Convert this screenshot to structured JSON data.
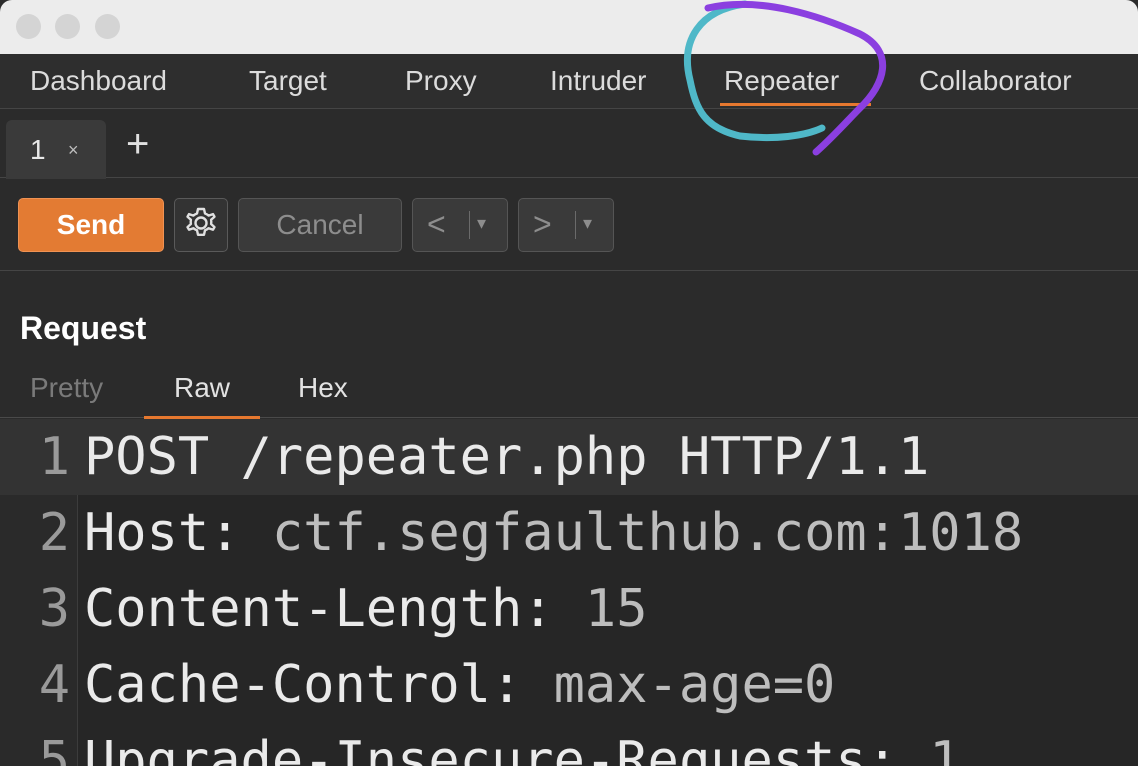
{
  "main_tabs": [
    {
      "label": "Dashboard"
    },
    {
      "label": "Target"
    },
    {
      "label": "Proxy"
    },
    {
      "label": "Intruder"
    },
    {
      "label": "Repeater"
    },
    {
      "label": "Collaborator"
    }
  ],
  "active_tab": "Repeater",
  "repeater_tabs": [
    {
      "label": "1",
      "close": "×"
    }
  ],
  "add_tab_label": "+",
  "toolbar": {
    "send_label": "Send",
    "cancel_label": "Cancel",
    "back_label": "<",
    "forward_label": ">",
    "dropdown_glyph": "▾",
    "settings_icon": "gear-icon"
  },
  "request": {
    "title": "Request",
    "view_tabs": [
      {
        "label": "Pretty"
      },
      {
        "label": "Raw"
      },
      {
        "label": "Hex"
      }
    ],
    "active_view": "Raw",
    "lines": [
      {
        "n": "1",
        "key": "POST /repeater.php HTTP/1.1",
        "value": ""
      },
      {
        "n": "2",
        "key": "Host:",
        "value": " ctf.segfaulthub.com:1018"
      },
      {
        "n": "3",
        "key": "Content-Length:",
        "value": " 15"
      },
      {
        "n": "4",
        "key": "Cache-Control:",
        "value": " max-age=0"
      },
      {
        "n": "5",
        "key": "Upgrade-Insecure-Requests:",
        "value": " 1"
      }
    ]
  },
  "colors": {
    "accent": "#e6782f",
    "annotation_purple": "#8b3fe0",
    "annotation_teal": "#4fb8c8"
  }
}
